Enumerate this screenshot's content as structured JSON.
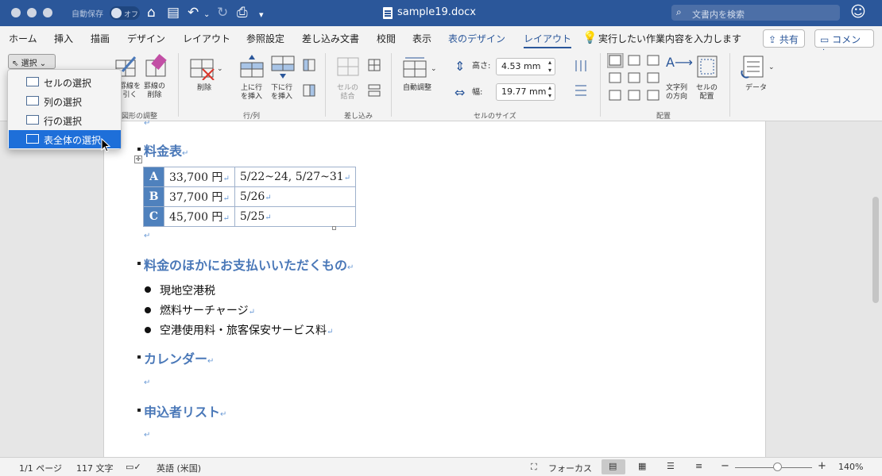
{
  "app": {
    "autosave_label": "自動保存",
    "autosave_state": "オフ",
    "doc_title": "sample19.docx",
    "search_placeholder": "文書内を検索"
  },
  "menu": {
    "tabs": [
      "ホーム",
      "挿入",
      "描画",
      "デザイン",
      "レイアウト",
      "参照設定",
      "差し込み文書",
      "校閲",
      "表示",
      "表のデザイン",
      "レイアウト"
    ],
    "active_tab_index": 10,
    "tell_me": "実行したい作業内容を入力します",
    "share": "共有",
    "comment": "コメント"
  },
  "ribbon": {
    "select_button": "選択",
    "draw_line": "罫線を\n引く",
    "erase_line": "罫線の\n削除",
    "group_draw": "図形の調整",
    "delete": "削除",
    "insert_above": "上に行\nを挿入",
    "insert_below": "下に行\nを挿入",
    "group_rows_cols": "行/列",
    "merge_cells": "セルの\n結合",
    "group_merge": "差し込み",
    "autofit": "自動調整",
    "height_label": "高さ:",
    "height_value": "4.53 mm",
    "width_label": "幅:",
    "width_value": "19.77 mm",
    "group_cell_size": "セルのサイズ",
    "text_direction": "文字列\nの方向",
    "cell_margins": "セルの\n配置",
    "group_alignment": "配置",
    "data": "データ"
  },
  "select_menu": {
    "items": [
      "セルの選択",
      "列の選択",
      "行の選択",
      "表全体の選択"
    ],
    "highlighted_index": 3
  },
  "document": {
    "heading_fee": "料金表",
    "table": [
      {
        "label": "A",
        "price": "33,700 円",
        "dates": "5/22~24, 5/27~31"
      },
      {
        "label": "B",
        "price": "37,700 円",
        "dates": "5/26"
      },
      {
        "label": "C",
        "price": "45,700 円",
        "dates": "5/25"
      }
    ],
    "heading_other": "料金のほかにお支払いいただくもの",
    "bullets": [
      "現地空港税",
      "燃料サーチャージ",
      "空港使用料・旅客保安サービス料"
    ],
    "heading_calendar": "カレンダー",
    "heading_applicants": "申込者リスト",
    "para_mark": "↵"
  },
  "status": {
    "page": "1/1 ページ",
    "words": "117 文字",
    "language": "英語 (米国)",
    "focus": "フォーカス",
    "zoom_minus": "−",
    "zoom_plus": "+",
    "zoom": "140%",
    "zoom_fraction": 0.55
  },
  "colors": {
    "brand": "#2b579a",
    "heading": "#4a78b8",
    "table_header": "#4f81bd",
    "menu_highlight": "#1e6fd9"
  }
}
